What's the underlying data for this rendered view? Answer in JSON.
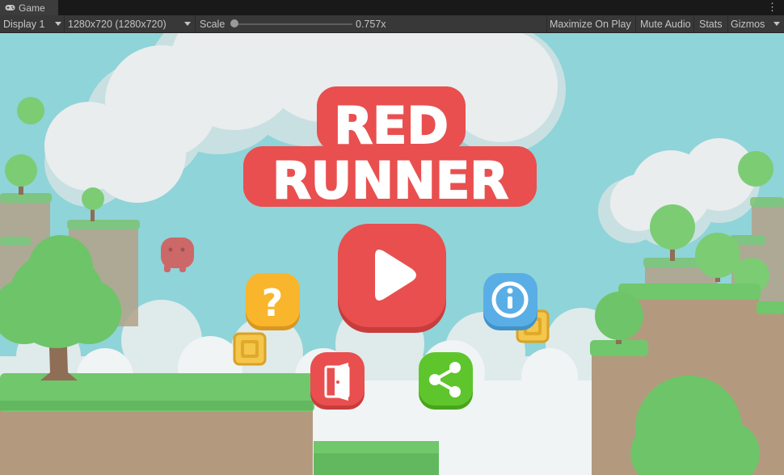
{
  "window": {
    "tab_label": "Game",
    "tab_icon": "gamepad-icon"
  },
  "toolbar": {
    "display": "Display 1",
    "resolution": "1280x720 (1280x720)",
    "scale_label": "Scale",
    "scale_value": "0.757x",
    "maximize": "Maximize On Play",
    "mute": "Mute Audio",
    "stats": "Stats",
    "gizmos": "Gizmos"
  },
  "game": {
    "title_line1": "RED",
    "title_line2": "RUNNER",
    "buttons": {
      "play": "play-icon",
      "help": "question-icon",
      "info": "info-icon",
      "exit": "door-exit-icon",
      "share": "share-icon"
    },
    "colors": {
      "sky": "#8fd4d8",
      "title_red": "#e94f4f",
      "play_red": "#e94f4f",
      "help_yellow": "#f9b52b",
      "info_blue": "#5aaee6",
      "share_green": "#5ec62c",
      "grass": "#71c76c",
      "dirt": "#b39a7f"
    }
  }
}
